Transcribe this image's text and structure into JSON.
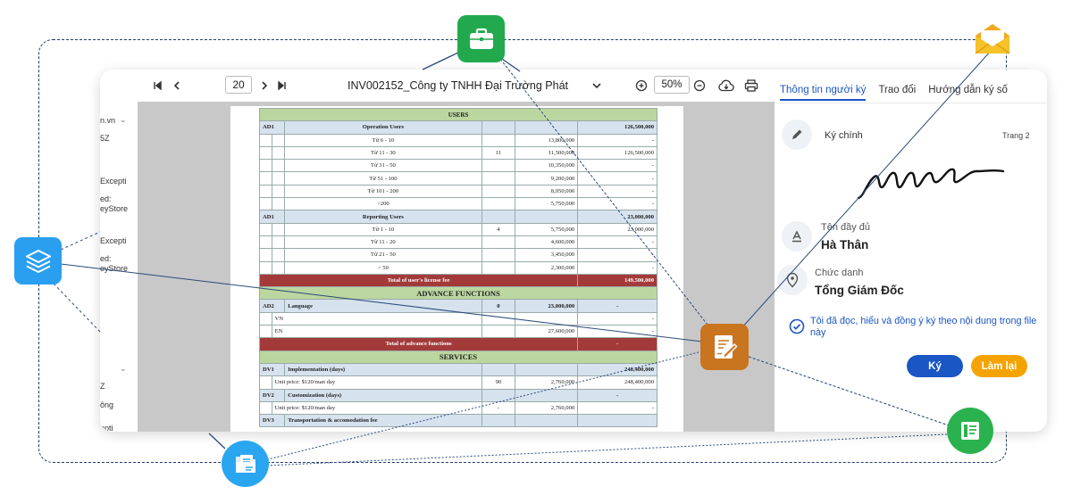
{
  "toolbar": {
    "page_number": "20",
    "document_title": "INV002152_Công ty TNHH Đại Trường Phát",
    "zoom": "50%"
  },
  "sidebar_fragments": {
    "line1": "n.vn",
    "line2": "5Z",
    "line3": "Excepti",
    "line4": "ed:",
    "line5": "eyStore",
    "line6": "Excepti",
    "line7": "ed:",
    "line8": "eyStore",
    "line9": "Z",
    "line10": "ông",
    "line11": "epti"
  },
  "sheet": {
    "users_header": "USERS",
    "ad1_code": "AD1",
    "operation_users": "Operation Users",
    "operation_total": "126,500,000",
    "op_rows": [
      {
        "tier": "Từ 6 - 10",
        "qty": "",
        "price": "13,800,000",
        "amount": "-"
      },
      {
        "tier": "Từ 11 - 30",
        "qty": "11",
        "price": "11,500,000",
        "amount": "126,500,000"
      },
      {
        "tier": "Từ 31 - 50",
        "qty": "",
        "price": "10,350,000",
        "amount": "-"
      },
      {
        "tier": "Từ 51 - 100",
        "qty": "",
        "price": "9,200,000",
        "amount": "-"
      },
      {
        "tier": "Từ 101 - 200",
        "qty": "",
        "price": "8,050,000",
        "amount": "-"
      },
      {
        "tier": ">200",
        "qty": "",
        "price": "5,750,000",
        "amount": "-"
      }
    ],
    "reporting_users": "Reporting Users",
    "reporting_total": "23,000,000",
    "rep_rows": [
      {
        "tier": "Từ 1 - 10",
        "qty": "4",
        "price": "5,750,000",
        "amount": "23,000,000"
      },
      {
        "tier": "Từ 11 - 20",
        "qty": "",
        "price": "4,600,000",
        "amount": "-"
      },
      {
        "tier": "Từ 21 - 50",
        "qty": "",
        "price": "3,450,000",
        "amount": "-"
      },
      {
        "tier": "> 50",
        "qty": "",
        "price": "2,300,000",
        "amount": "-"
      }
    ],
    "total_users_label": "Total of user's license fee",
    "total_users_value": "149,500,000",
    "advance_header": "ADVANCE FUNCTIONS",
    "language_code": "AD2",
    "language_label": "Language",
    "language_qty": "0",
    "language_price": "23,000,000",
    "language_amount": "-",
    "vn_label": "VN",
    "vn_amount": "-",
    "en_label": "EN",
    "en_price": "27,600,000",
    "en_amount": "-",
    "total_advance_label": "Total of advance functions",
    "total_advance_value": "-",
    "services_header": "SERVICES",
    "dv1_code": "DV1",
    "dv1_label": "Implementation (days)",
    "dv1_total": "248,400,000",
    "dv1_unit": "Unit price: $120/man day",
    "dv1_qty": "90",
    "dv1_price": "2,760,000",
    "dv1_amount": "248,400,000",
    "dv2_code": "DV2",
    "dv2_label": "Customization (days)",
    "dv2_total": "-",
    "dv2_unit": "Unit price: $120/man day",
    "dv2_qty": "-",
    "dv2_price": "2,760,000",
    "dv2_amount": "-",
    "dv3_code": "DV3",
    "dv3_label": "Transportation & accomodation fee"
  },
  "panel": {
    "tabs": [
      "Thông tin người ký",
      "Trao đổi",
      "Hướng dẫn ký số"
    ],
    "main_signer_label": "Ký chính",
    "page_ref": "Trang 2",
    "full_name_label": "Tên đầy đủ",
    "full_name": "Hà Thân",
    "position_label": "Chức danh",
    "position": "Tổng Giám Đốc",
    "agreement": "Tôi đã đọc, hiểu và đồng ý ký theo nội dung trong file này",
    "sign_button": "Ký",
    "reset_button": "Làm lại"
  },
  "colors": {
    "primary_blue": "#1a56c4",
    "reset_orange": "#f5a300",
    "briefcase_green": "#22a94e",
    "layers_blue": "#2a9ff0",
    "form_orange": "#c9741f",
    "sheet_green": "#2ab24f",
    "folder_blue": "#2aa6f0",
    "mail_yellow": "#f5c22a",
    "table_header_green": "#bcd6a0",
    "table_header_blue": "#d6e2ee",
    "table_total_red": "#a33a3a"
  },
  "icons": [
    "briefcase-icon",
    "mail-icon",
    "layers-icon",
    "sign-document-icon",
    "spreadsheet-icon",
    "folder-document-icon",
    "pen-icon",
    "font-icon",
    "location-badge-icon",
    "check-circle-icon",
    "first-page-icon",
    "prev-page-icon",
    "next-page-icon",
    "last-page-icon",
    "chevron-down-icon",
    "zoom-in-icon",
    "zoom-out-icon",
    "cloud-download-icon",
    "print-icon"
  ]
}
